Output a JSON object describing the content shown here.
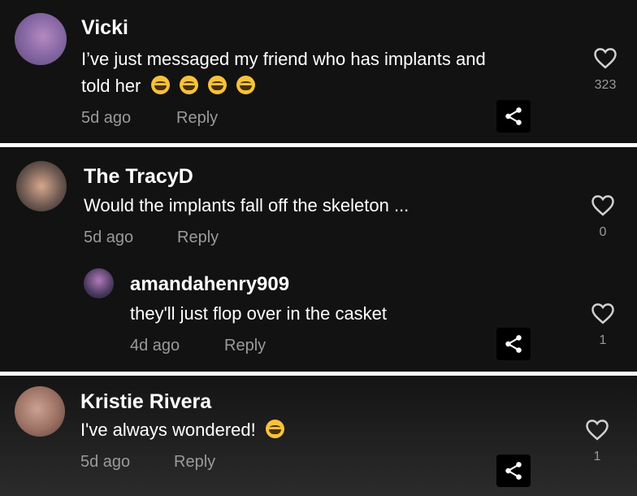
{
  "comments": [
    {
      "author": "Vicki",
      "text": "I’ve just messaged my friend who has implants and",
      "text_line2": "told her",
      "time": "5d ago",
      "reply_label": "Reply",
      "likes": "323"
    },
    {
      "author": "The TracyD",
      "text": "Would the implants fall off the skeleton ...",
      "time": "5d ago",
      "reply_label": "Reply",
      "likes": "0",
      "replies": [
        {
          "author": "amandahenry909",
          "text": "they'll just flop over in the casket",
          "time": "4d ago",
          "reply_label": "Reply",
          "likes": "1"
        }
      ]
    },
    {
      "author": "Kristie Rivera",
      "text": "I've always wondered!",
      "time": "5d ago",
      "reply_label": "Reply",
      "likes": "1"
    }
  ],
  "icons": {
    "like": "heart-outline-icon",
    "share": "share-icon",
    "emoji_laugh": "grinning-squinting-face-emoji"
  },
  "colors": {
    "panel_bg": "#121212",
    "text_primary": "#ffffff",
    "text_secondary": "#9a9a9a",
    "emoji": "#f7c23a"
  }
}
